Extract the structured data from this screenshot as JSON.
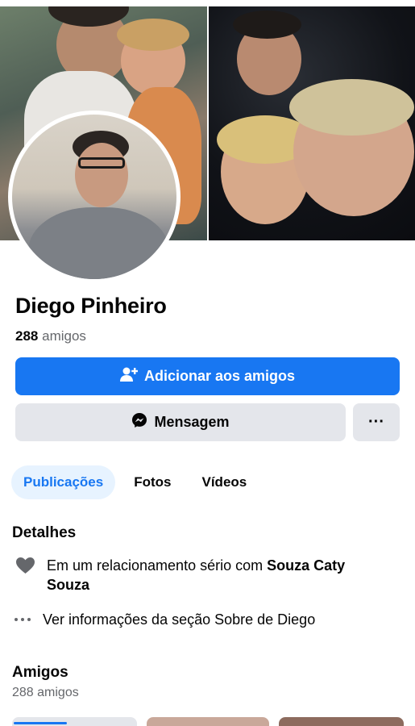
{
  "profile": {
    "name": "Diego Pinheiro",
    "friends_count": "288",
    "friends_word": "amigos"
  },
  "actions": {
    "add_friend_label": "Adicionar aos amigos",
    "message_label": "Mensagem",
    "more_label": "···"
  },
  "tabs": [
    {
      "label": "Publicações",
      "active": true
    },
    {
      "label": "Fotos",
      "active": false
    },
    {
      "label": "Vídeos",
      "active": false
    }
  ],
  "details": {
    "title": "Detalhes",
    "relationship_prefix": "Em um relacionamento sério com ",
    "relationship_partner_line1": "Souza Caty",
    "relationship_partner_line2": "Souza",
    "about_link": "Ver informações da seção Sobre de Diego"
  },
  "friends_section": {
    "title": "Amigos",
    "subtitle": "288 amigos"
  },
  "colors": {
    "brand_blue": "#1877f2",
    "secondary_gray": "#e4e6eb",
    "muted_text": "#65676b",
    "active_tab_bg": "#e7f3ff"
  },
  "icons": {
    "add_friend": "person-plus-icon",
    "message": "messenger-icon",
    "relationship": "heart-icon",
    "about": "more-dots-icon"
  }
}
